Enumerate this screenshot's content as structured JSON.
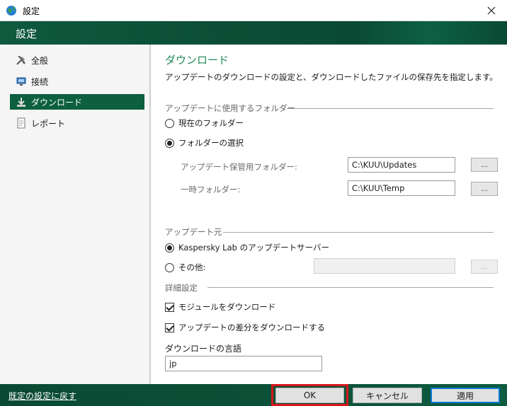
{
  "window": {
    "title": "設定",
    "header_title": "設定"
  },
  "sidebar": {
    "items": [
      {
        "label": "全般",
        "icon": "tools-icon",
        "active": false
      },
      {
        "label": "接続",
        "icon": "network-icon",
        "active": false
      },
      {
        "label": "ダウンロード",
        "icon": "download-icon",
        "active": true
      },
      {
        "label": "レポート",
        "icon": "report-icon",
        "active": false
      }
    ]
  },
  "main": {
    "title": "ダウンロード",
    "description": "アップデートのダウンロードの設定と、ダウンロードしたファイルの保存先を指定します。",
    "folder_group": {
      "label": "アップデートに使用するフォルダー",
      "option_current": "現在のフォルダー",
      "option_select": "フォルダーの選択",
      "selected": "select",
      "storage_label": "アップデート保管用フォルダー:",
      "storage_value": "C:\\KUU\\Updates",
      "temp_label": "一時フォルダー:",
      "temp_value": "C:\\KUU\\Temp",
      "browse_label": "..."
    },
    "source_group": {
      "label": "アップデート元",
      "option_kaspersky": "Kaspersky Lab のアップデートサーバー",
      "option_other": "その他:",
      "selected": "kaspersky",
      "other_value": "",
      "browse_label": "..."
    },
    "advanced_group": {
      "label": "詳細設定",
      "download_modules": "モジュールをダウンロード",
      "download_modules_checked": true,
      "download_diff": "アップデートの差分をダウンロードする",
      "download_diff_checked": true
    },
    "language": {
      "label": "ダウンロードの言語",
      "value": "jp"
    }
  },
  "footer": {
    "reset_label": "既定の設定に戻す",
    "ok_label": "OK",
    "cancel_label": "キャンセル",
    "apply_label": "適用"
  },
  "colors": {
    "brand_green": "#0c5f3f",
    "title_green": "#1b8a5a",
    "highlight_red": "#d6171c",
    "focus_blue": "#0a78d4"
  }
}
